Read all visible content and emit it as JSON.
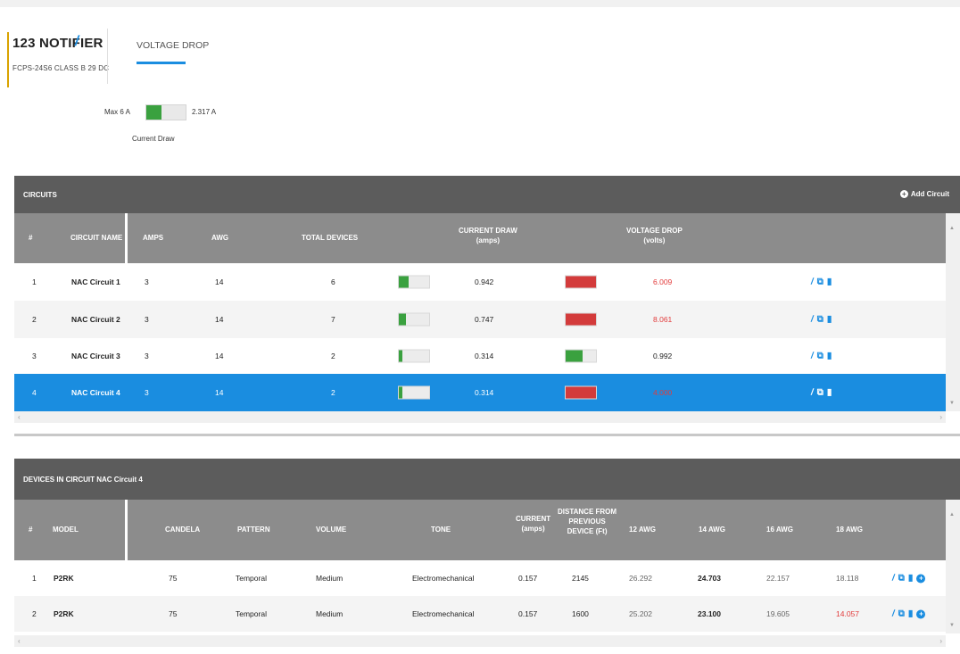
{
  "header": {
    "project_title": "123  NOTIFIER",
    "edit_icon": "pencil-icon",
    "subtitle": "FCPS-24S6  CLASS B  29  DC",
    "tab_label": "VOLTAGE DROP"
  },
  "current_draw": {
    "max_label": "Max 6 A",
    "value_label": "2.317 A",
    "caption": "Current Draw",
    "fill_fraction": 0.386
  },
  "circuits": {
    "title": "CIRCUITS",
    "add_label": "Add Circuit",
    "columns": {
      "num": "#",
      "name": "CIRCUIT NAME",
      "amps": "AMPS",
      "awg": "AWG",
      "devices": "TOTAL DEVICES",
      "current_draw_1": "CURRENT DRAW",
      "current_draw_2": "(amps)",
      "voltage_drop_1": "VOLTAGE DROP",
      "voltage_drop_2": "(volts)"
    },
    "rows": [
      {
        "num": "1",
        "name": "NAC Circuit 1",
        "amps": "3",
        "awg": "14",
        "devices": "6",
        "current": "0.942",
        "current_fill": 0.314,
        "voltage": "6.009",
        "voltage_fill": 1.0,
        "voltage_red": true
      },
      {
        "num": "2",
        "name": "NAC Circuit 2",
        "amps": "3",
        "awg": "14",
        "devices": "7",
        "current": "0.747",
        "current_fill": 0.249,
        "voltage": "8.061",
        "voltage_fill": 1.0,
        "voltage_red": true
      },
      {
        "num": "3",
        "name": "NAC Circuit 3",
        "amps": "3",
        "awg": "14",
        "devices": "2",
        "current": "0.314",
        "current_fill": 0.105,
        "voltage": "0.992",
        "voltage_fill": 0.55,
        "voltage_red": false
      },
      {
        "num": "4",
        "name": "NAC Circuit 4",
        "amps": "3",
        "awg": "14",
        "devices": "2",
        "current": "0.314",
        "current_fill": 0.105,
        "voltage": "4.000",
        "voltage_fill": 1.0,
        "voltage_red": true
      }
    ]
  },
  "devices": {
    "title": "DEVICES IN CIRCUIT NAC Circuit 4",
    "columns": {
      "num": "#",
      "model": "MODEL",
      "candela": "CANDELA",
      "pattern": "PATTERN",
      "volume": "VOLUME",
      "tone": "TONE",
      "current_1": "CURRENT",
      "current_2": "(amps)",
      "dist_1": "DISTANCE FROM",
      "dist_2": "PREVIOUS",
      "dist_3": "DEVICE (Ft)",
      "awg12": "12 AWG",
      "awg14": "14 AWG",
      "awg16": "16 AWG",
      "awg18": "18 AWG"
    },
    "rows": [
      {
        "num": "1",
        "model": "P2RK",
        "candela": "75",
        "pattern": "Temporal",
        "volume": "Medium",
        "tone": "Electromechanical",
        "current": "0.157",
        "distance": "2145",
        "awg12": "26.292",
        "awg14": "24.703",
        "awg16": "22.157",
        "awg18": "18.118",
        "awg18_red": false
      },
      {
        "num": "2",
        "model": "P2RK",
        "candela": "75",
        "pattern": "Temporal",
        "volume": "Medium",
        "tone": "Electromechanical",
        "current": "0.157",
        "distance": "1600",
        "awg12": "25.202",
        "awg14": "23.100",
        "awg16": "19.605",
        "awg18": "14.057",
        "awg18_red": true
      }
    ]
  },
  "colors": {
    "accent": "#1a8de0",
    "green": "#3aa13f",
    "red": "#d33b3b",
    "panel_header": "#5c5c5c",
    "table_header": "#8c8c8c"
  }
}
